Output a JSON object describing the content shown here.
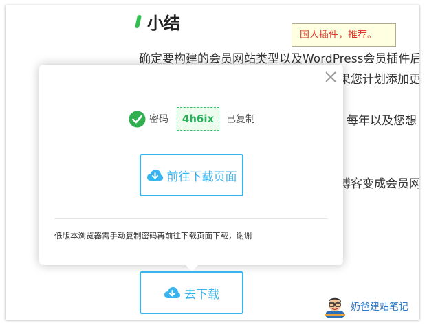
{
  "article": {
    "heading": "小结",
    "line1": "确定要构建的会员网站类型以及WordPress会员插件后",
    "line2": "果您计划添加更",
    "line3": "每年以及您想",
    "line4": "博客变成会员网"
  },
  "note": {
    "text": "国人插件，推荐。"
  },
  "modal": {
    "password_label": "密码",
    "password_value": "4h6ix",
    "copied_label": "已复制",
    "go_download_label": "前往下载页面",
    "tip": "低版本浏览器需手动复制密码再前往下载页面下载，谢谢"
  },
  "download_button": {
    "label": "去下载"
  },
  "brand": {
    "text": "奶爸建站笔记"
  },
  "colors": {
    "accent": "#39b4ee",
    "success": "#2aaf5a",
    "heading_bar": "#31c04f",
    "note_text": "#e0362c"
  }
}
